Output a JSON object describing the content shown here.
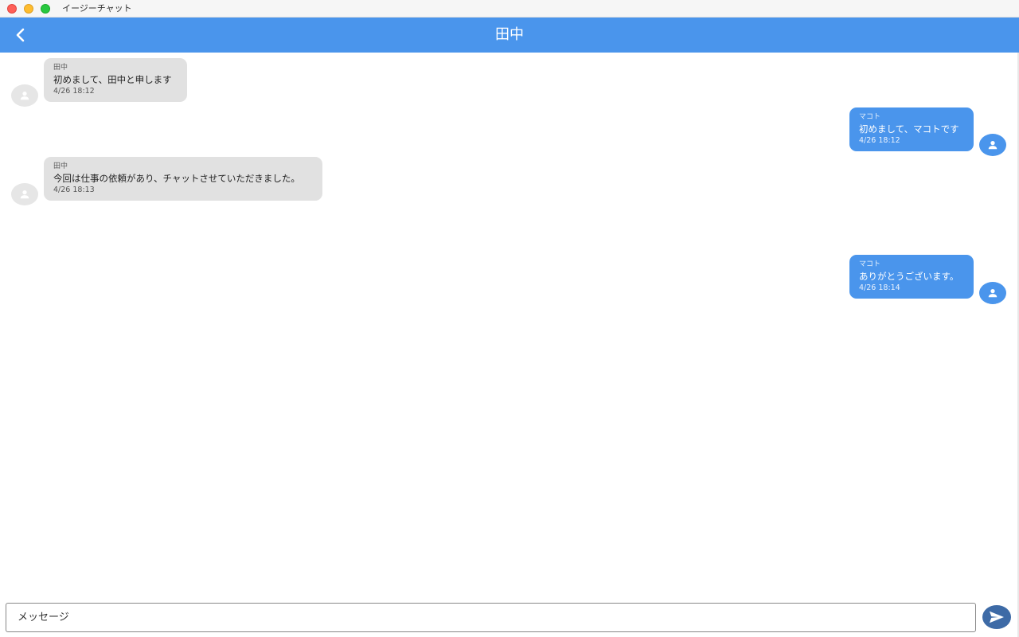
{
  "window": {
    "title": "イージーチャット"
  },
  "header": {
    "title": "田中",
    "back_icon": "chevron-left-icon"
  },
  "messages": [
    {
      "sender": "田中",
      "text": "初めまして、田中と申します",
      "time": "4/26 18:12",
      "side": "other"
    },
    {
      "sender": "マコト",
      "text": "初めまして、マコトです",
      "time": "4/26 18:12",
      "side": "self"
    },
    {
      "sender": "田中",
      "text": "今回は仕事の依頼があり、チャットさせていただきました。",
      "time": "4/26 18:13",
      "side": "other"
    },
    {
      "sender": "マコト",
      "text": "ありがとうございます。",
      "time": "4/26 18:14",
      "side": "self"
    }
  ],
  "composer": {
    "placeholder": "メッセージ",
    "send_icon": "send-icon"
  },
  "colors": {
    "accent": "#4a95ec",
    "other_bubble": "#e1e1e1",
    "send_button": "#3d6aa6"
  }
}
